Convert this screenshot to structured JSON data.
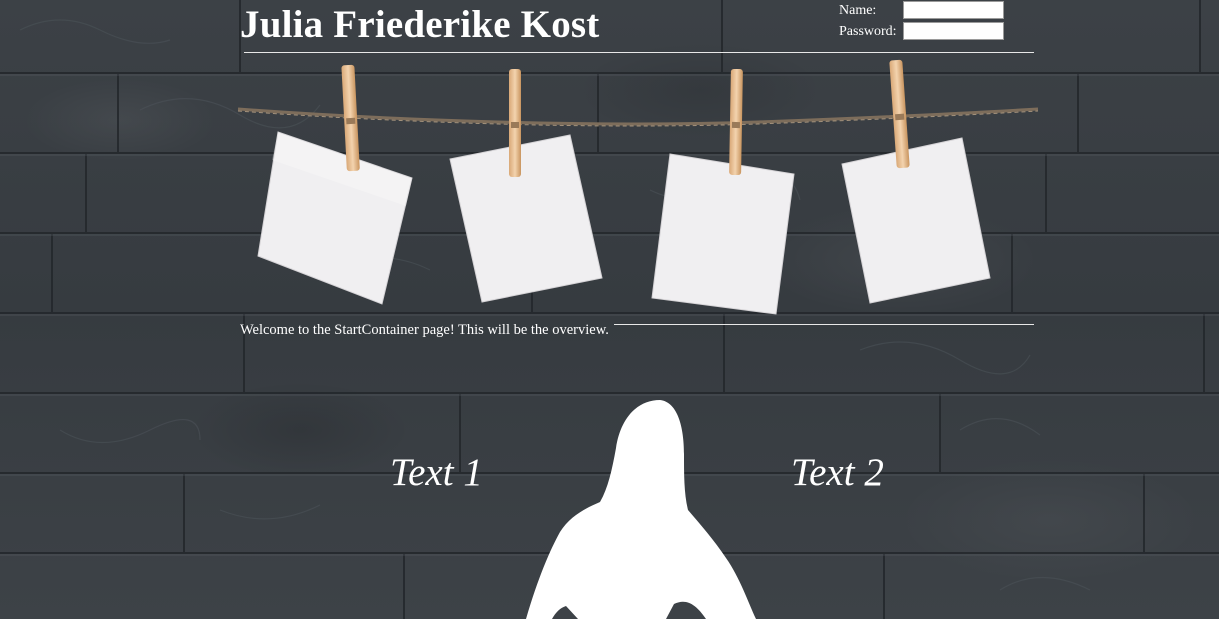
{
  "header": {
    "title": "Julia Friederike Kost"
  },
  "login": {
    "name_label": "Name:",
    "password_label": "Password:",
    "name_value": "",
    "password_value": ""
  },
  "main": {
    "welcome_text": "Welcome to the StartContainer page! This will be the overview.",
    "text1": "Text 1",
    "text2": "Text 2"
  },
  "colors": {
    "background": "#3a3f44",
    "text": "#ffffff",
    "card": "#ecebed",
    "clothespin": "#e9c49e",
    "rope": "#8a7a66"
  }
}
